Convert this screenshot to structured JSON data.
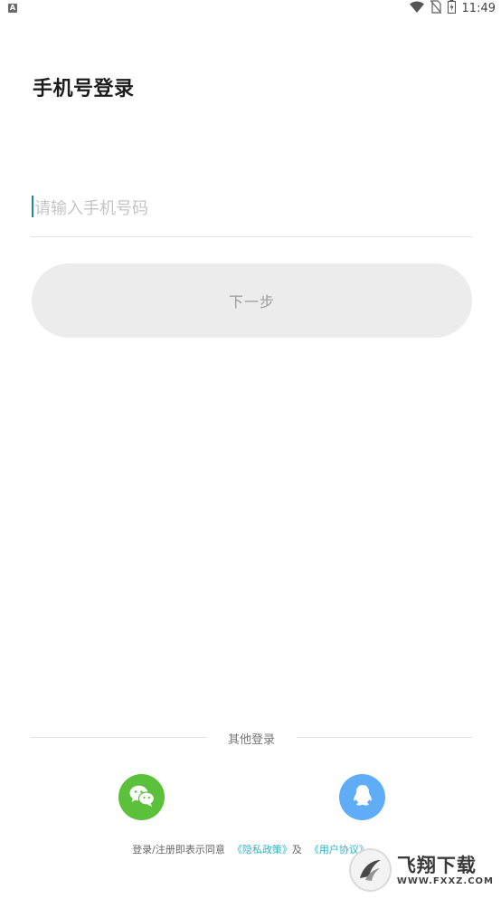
{
  "status_bar": {
    "app_indicator": "A",
    "time": "11:49",
    "icons": [
      "wifi-icon",
      "no-sim-icon",
      "battery-charging-icon"
    ]
  },
  "login": {
    "title": "手机号登录",
    "phone_placeholder": "请输入手机号码",
    "phone_value": "",
    "next_button": "下一步"
  },
  "other_login": {
    "label": "其他登录",
    "options": [
      {
        "name": "wechat",
        "icon": "wechat-icon",
        "color": "#5bc13a"
      },
      {
        "name": "qq",
        "icon": "qq-icon",
        "color": "#5fadf7"
      }
    ]
  },
  "agreement": {
    "prefix": "登录/注册即表示同意",
    "privacy_link": "《隐私政策》",
    "conjunction": "及",
    "terms_link": "《用户协议》"
  },
  "watermark": {
    "brand": "飞翔下载",
    "url": "WWW.FXXZ.COM"
  },
  "colors": {
    "accent": "#1a8f8f",
    "link": "#2bb3c9",
    "button_disabled_bg": "#ececec"
  }
}
